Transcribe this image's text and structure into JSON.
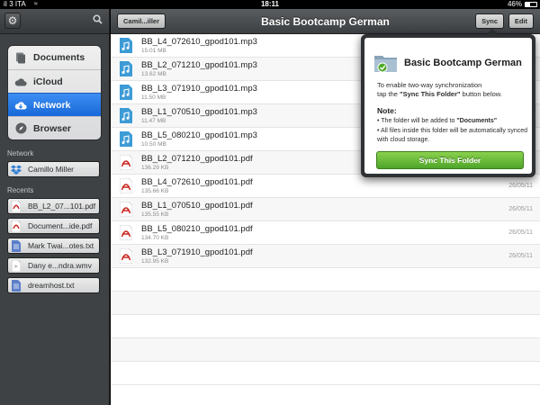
{
  "status_bar": {
    "carrier": "iI 3 ITA",
    "time": "18:11",
    "battery": "46%"
  },
  "sidebar": {
    "nav": [
      {
        "label": "Documents",
        "icon": "documents-icon"
      },
      {
        "label": "iCloud",
        "icon": "cloud-icon"
      },
      {
        "label": "Network",
        "icon": "network-icon",
        "active": true
      },
      {
        "label": "Browser",
        "icon": "compass-icon"
      }
    ],
    "network_header": "Network",
    "network_items": [
      {
        "label": "Camillo Miller",
        "icon": "dropbox-icon"
      }
    ],
    "recents_header": "Recents",
    "recents": [
      {
        "label": "BB_L2_07...101.pdf",
        "icon": "pdf-file-icon"
      },
      {
        "label": "Document...ide.pdf",
        "icon": "pdf-file-icon"
      },
      {
        "label": "Mark Twai...otes.txt",
        "icon": "text-file-icon"
      },
      {
        "label": "Dany e...ndra.wmv",
        "icon": "video-file-icon"
      },
      {
        "label": "dreamhost.txt",
        "icon": "text-file-icon"
      }
    ]
  },
  "toolbar": {
    "back_label": "Camil...iller",
    "title": "Basic Bootcamp German",
    "sync_label": "Sync",
    "edit_label": "Edit"
  },
  "files": [
    {
      "name": "BB_L4_072610_gpod101.mp3",
      "size": "15.01 MB",
      "date": "",
      "type": "audio"
    },
    {
      "name": "BB_L2_071210_gpod101.mp3",
      "size": "13.62 MB",
      "date": "",
      "type": "audio"
    },
    {
      "name": "BB_L3_071910_gpod101.mp3",
      "size": "11.50 MB",
      "date": "",
      "type": "audio"
    },
    {
      "name": "BB_L1_070510_gpod101.mp3",
      "size": "11.47 MB",
      "date": "",
      "type": "audio"
    },
    {
      "name": "BB_L5_080210_gpod101.mp3",
      "size": "10.50 MB",
      "date": "",
      "type": "audio"
    },
    {
      "name": "BB_L2_071210_gpod101.pdf",
      "size": "136.29 KB",
      "date": "",
      "type": "pdf"
    },
    {
      "name": "BB_L4_072610_gpod101.pdf",
      "size": "135.66 KB",
      "date": "26/05/11",
      "type": "pdf"
    },
    {
      "name": "BB_L1_070510_gpod101.pdf",
      "size": "135.55 KB",
      "date": "26/05/11",
      "type": "pdf"
    },
    {
      "name": "BB_L5_080210_gpod101.pdf",
      "size": "134.70 KB",
      "date": "26/05/11",
      "type": "pdf"
    },
    {
      "name": "BB_L3_071910_gpod101.pdf",
      "size": "132.95 KB",
      "date": "26/05/11",
      "type": "pdf"
    }
  ],
  "popover": {
    "title": "Basic Bootcamp German",
    "desc_line1": "To enable two-way synchronization",
    "desc_line2_pre": "tap the ",
    "desc_line2_bold": "\"Sync This Folder\"",
    "desc_line2_post": " button below.",
    "note_label": "Note:",
    "bullet1_pre": "• The folder will be added to ",
    "bullet1_bold": "\"Documents\"",
    "bullet2": "• All files inside this folder will be automatically synced with cloud storage.",
    "button_label": "Sync This Folder"
  },
  "colors": {
    "active_blue": "#2a7de6",
    "sync_green": "#5fb634",
    "pdf_red": "#c8261f",
    "audio_blue": "#3d9bd6"
  }
}
